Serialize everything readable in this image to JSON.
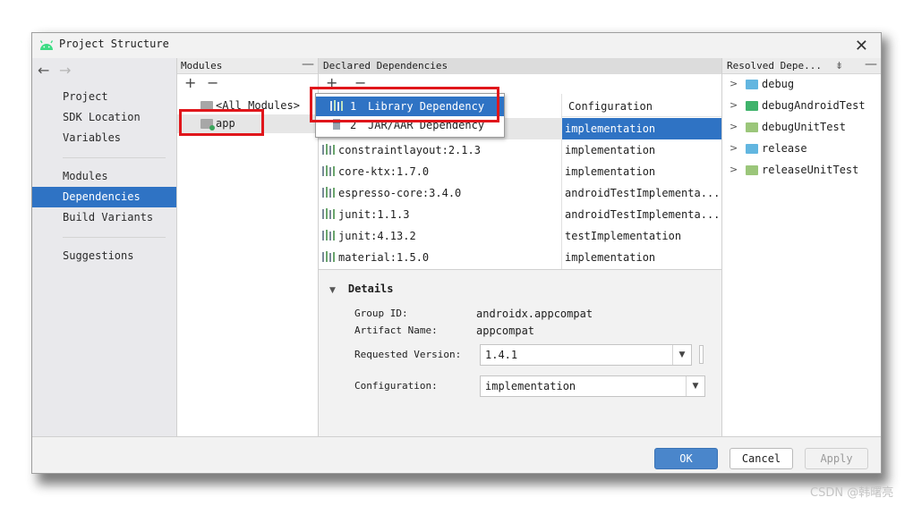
{
  "window": {
    "title": "Project Structure",
    "close": "✕"
  },
  "nav": {
    "back": "←",
    "forward": "→",
    "items": [
      "Project",
      "SDK Location",
      "Variables",
      "Modules",
      "Dependencies",
      "Build Variants",
      "Suggestions"
    ],
    "selected": "Dependencies"
  },
  "modules": {
    "header": "Modules",
    "header_action": "—",
    "add": "+",
    "remove": "−",
    "items": [
      "<All Modules>",
      "app"
    ]
  },
  "dependencies": {
    "header": "Declared Dependencies",
    "add": "+",
    "remove": "−",
    "config_header": "Configuration",
    "rows": [
      {
        "name": "",
        "configuration": "implementation"
      },
      {
        "name": "constraintlayout:2.1.3",
        "configuration": "implementation"
      },
      {
        "name": "core-ktx:1.7.0",
        "configuration": "implementation"
      },
      {
        "name": "espresso-core:3.4.0",
        "configuration": "androidTestImplementa..."
      },
      {
        "name": "junit:1.1.3",
        "configuration": "androidTestImplementa..."
      },
      {
        "name": "junit:4.13.2",
        "configuration": "testImplementation"
      },
      {
        "name": "material:1.5.0",
        "configuration": "implementation"
      }
    ]
  },
  "popup": {
    "items": [
      {
        "num": "1",
        "label": "Library Dependency"
      },
      {
        "num": "2",
        "label": "JAR/AAR Dependency"
      }
    ]
  },
  "details": {
    "title": "Details",
    "group_label": "Group ID:",
    "group_value": "androidx.appcompat",
    "artifact_label": "Artifact Name:",
    "artifact_value": "appcompat",
    "version_label": "Requested Version:",
    "version_value": "1.4.1",
    "config_label": "Configuration:",
    "config_value": "implementation"
  },
  "resolved": {
    "header": "Resolved Depe...",
    "collapse": "⇟",
    "header_action": "—",
    "items": [
      {
        "label": "debug",
        "color": "#62b6e0"
      },
      {
        "label": "debugAndroidTest",
        "color": "#3fb36b"
      },
      {
        "label": "debugUnitTest",
        "color": "#9bc67a"
      },
      {
        "label": "release",
        "color": "#62b6e0"
      },
      {
        "label": "releaseUnitTest",
        "color": "#9bc67a"
      }
    ]
  },
  "buttons": {
    "ok": "OK",
    "cancel": "Cancel",
    "apply": "Apply"
  },
  "watermark": "CSDN @韩曙亮",
  "colors": {
    "accent": "#2f73c4",
    "highlight": "#e0161b"
  }
}
